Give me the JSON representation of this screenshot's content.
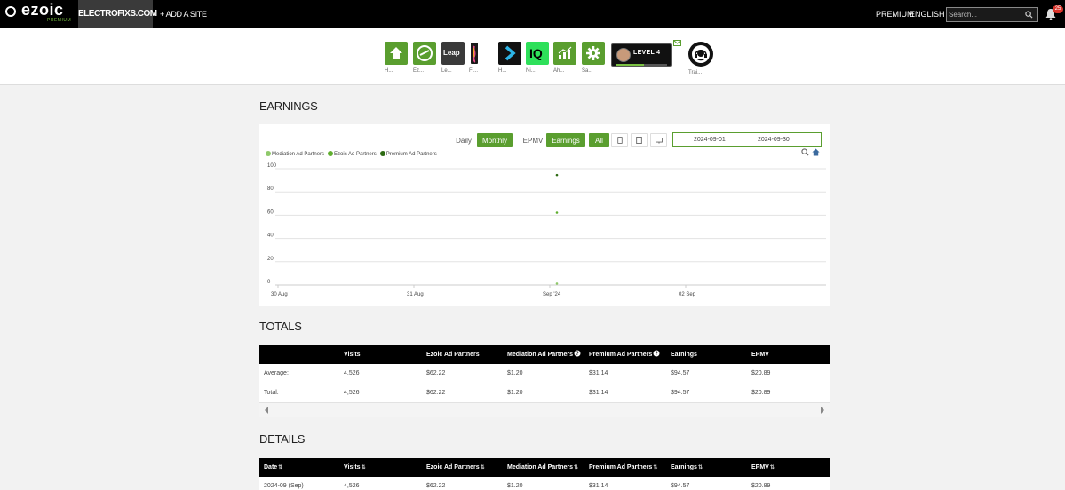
{
  "topbar": {
    "logo_text": "ezoic",
    "logo_sub": "PREMIUM",
    "site": "ELECTROFIXS.COM",
    "add_site": "+ ADD A SITE",
    "premium": "PREMIUM",
    "language": "ENGLISH ▾",
    "search_placeholder": "Search...",
    "notification_count": "25"
  },
  "apps": [
    {
      "label": "H...",
      "icon": "home-icon",
      "color": "#5a9e2f"
    },
    {
      "label": "Ez...",
      "icon": "ezoic-icon",
      "color": "#5a9e2f"
    },
    {
      "label": "Le...",
      "icon": "leap-icon",
      "color": "#3a3a3a",
      "tile_text": "Leap"
    },
    {
      "label": "Fl...",
      "icon": "flex-icon",
      "color": "#1a1a1a"
    },
    {
      "label": "H...",
      "icon": "humix-icon",
      "color": "#111111"
    },
    {
      "label": "Ni...",
      "icon": "niche-iq-icon",
      "color": "#2ee05a",
      "tile_text": "IQ"
    },
    {
      "label": "Ah...",
      "icon": "analytics-icon",
      "color": "#5a9e2f"
    },
    {
      "label": "Sa...",
      "icon": "settings-icon",
      "color": "#5a9e2f"
    }
  ],
  "level": {
    "text": "LEVEL 4",
    "progress": 0.55
  },
  "training": {
    "label": "Trai..."
  },
  "earnings": {
    "title": "EARNINGS",
    "buttons": {
      "daily": "Daily",
      "monthly": "Monthly",
      "epmv": "EPMV",
      "earnings": "Earnings",
      "all": "All"
    },
    "date_from": "2024-09-01",
    "date_sep": "~",
    "date_to": "2024-09-30"
  },
  "chart_data": {
    "type": "scatter",
    "title": "",
    "xlabel": "",
    "ylabel": "",
    "x_ticks": [
      "30 Aug",
      "31 Aug",
      "Sep '24",
      "02 Sep"
    ],
    "y_ticks": [
      0,
      20,
      40,
      60,
      80,
      100
    ],
    "ylim": [
      0,
      100
    ],
    "grid": true,
    "legend_position": "top-left",
    "series": [
      {
        "name": "Mediation Ad Partners",
        "color": "#8fc96a",
        "points": [
          {
            "x": "Sep '24",
            "y": 1.2
          }
        ]
      },
      {
        "name": "Ezoic Ad Partners",
        "color": "#5fae2e",
        "points": [
          {
            "x": "Sep '24",
            "y": 62.22
          }
        ]
      },
      {
        "name": "Premium Ad Partners",
        "color": "#2d6a12",
        "points": [
          {
            "x": "Sep '24",
            "y": 94.57
          }
        ]
      }
    ]
  },
  "totals": {
    "title": "TOTALS",
    "headers": [
      "",
      "Visits",
      "Ezoic Ad Partners",
      "Mediation Ad Partners",
      "Premium Ad Partners",
      "Earnings",
      "EPMV"
    ],
    "rows": [
      [
        "Average:",
        "4,526",
        "$62.22",
        "$1.20",
        "$31.14",
        "$94.57",
        "$20.89"
      ],
      [
        "Total:",
        "4,526",
        "$62.22",
        "$1.20",
        "$31.14",
        "$94.57",
        "$20.89"
      ]
    ]
  },
  "details": {
    "title": "DETAILS",
    "headers": [
      "Date",
      "Visits",
      "Ezoic Ad Partners",
      "Mediation Ad Partners",
      "Premium Ad Partners",
      "Earnings",
      "EPMV"
    ],
    "rows": [
      [
        "2024-09 (Sep)",
        "4,526",
        "$62.22",
        "$1.20",
        "$31.14",
        "$94.57",
        "$20.89"
      ]
    ]
  }
}
